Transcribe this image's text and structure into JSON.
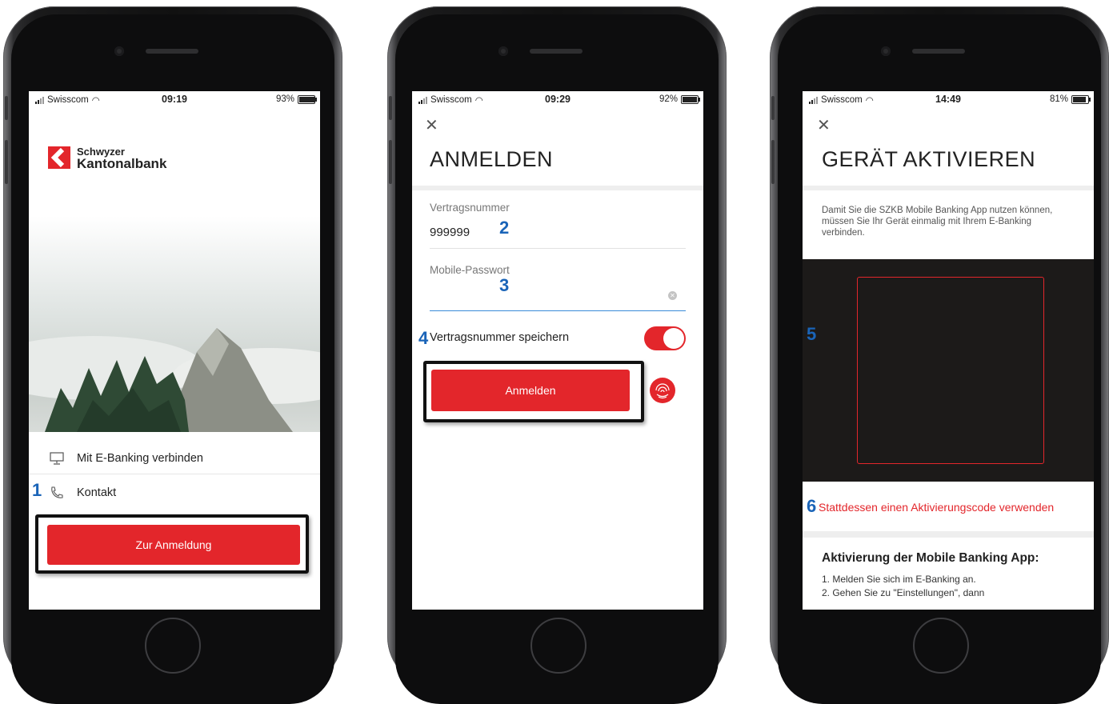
{
  "colors": {
    "brand_red": "#e3262b",
    "callout_blue": "#1a64b8",
    "toggle_on": "#e3262b"
  },
  "phone1": {
    "status": {
      "carrier": "Swisscom",
      "time": "09:19",
      "battery": "93%",
      "battery_level": 0.93
    },
    "logo": {
      "line1": "Schwyzer",
      "line2": "Kantonalbank"
    },
    "menu": [
      {
        "label": "Mit E-Banking verbinden",
        "icon": "monitor-icon"
      },
      {
        "label": "Kontakt",
        "icon": "phone-icon"
      }
    ],
    "login_button": "Zur Anmeldung",
    "callout": "1"
  },
  "phone2": {
    "status": {
      "carrier": "Swisscom",
      "time": "09:29",
      "battery": "92%",
      "battery_level": 0.92
    },
    "title": "ANMELDEN",
    "contract_label": "Vertragsnummer",
    "contract_value": "999999",
    "password_label": "Mobile-Passwort",
    "save_label": "Vertragsnummer speichern",
    "save_enabled": true,
    "login_button": "Anmelden",
    "callouts": {
      "contract": "2",
      "password": "3",
      "save": "4"
    }
  },
  "phone3": {
    "status": {
      "carrier": "Swisscom",
      "time": "14:49",
      "battery": "81%",
      "battery_level": 0.81
    },
    "title": "GERÄT AKTIVIEREN",
    "description": "Damit Sie die SZKB Mobile Banking App nutzen können, müssen Sie Ihr Gerät einmalig mit Ihrem E-Banking verbinden.",
    "alt_link": "Stattdessen einen Aktivierungscode verwenden",
    "instructions_title": "Aktivierung der Mobile Banking App:",
    "steps": [
      "1. Melden Sie sich im E-Banking an.",
      "2. Gehen Sie zu \"Einstellungen\", dann"
    ],
    "callouts": {
      "scanner": "5",
      "link": "6"
    }
  }
}
